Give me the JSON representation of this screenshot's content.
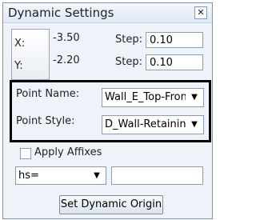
{
  "window": {
    "title": "Dynamic Settings",
    "close_glyph": "✕"
  },
  "coords": {
    "x_label": "X:",
    "x_value": "-3.50",
    "y_label": "Y:",
    "y_value": "-2.20",
    "step_label": "Step:",
    "x_step": "0.10",
    "y_step": "0.10"
  },
  "point": {
    "name_label": "Point Name:",
    "name_value": "Wall_E_Top-Front",
    "style_label": "Point Style:",
    "style_value": "D_Wall-Retaining"
  },
  "affixes": {
    "label": "Apply Affixes",
    "checked": false,
    "dropdown_value": "hs=",
    "text_value": ""
  },
  "actions": {
    "set_origin_label": "Set Dynamic Origin"
  },
  "icons": {
    "dropdown_arrow": "chevron-down-icon",
    "close": "close-icon"
  }
}
